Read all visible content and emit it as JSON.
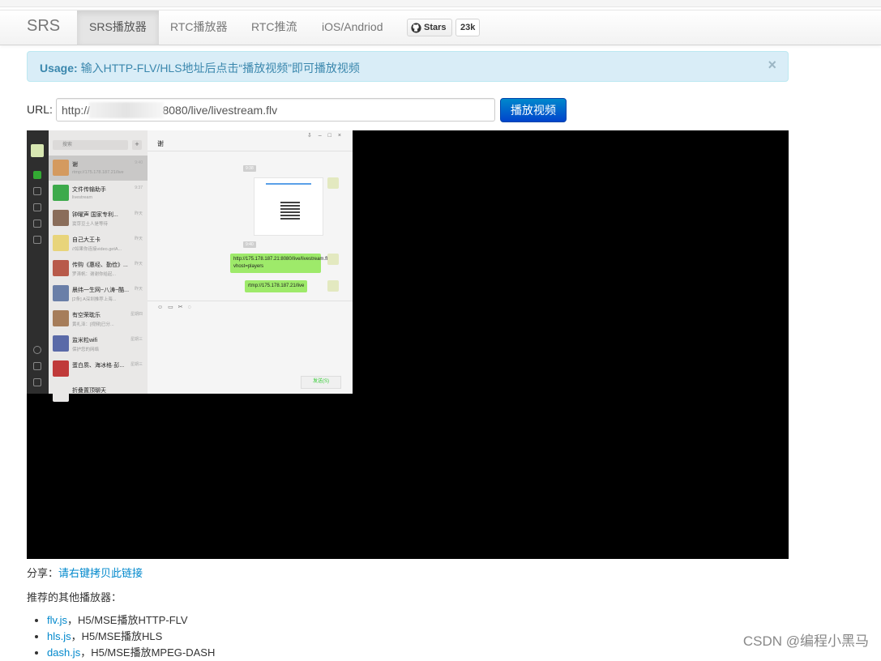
{
  "navbar": {
    "brand": "SRS",
    "tabs": [
      {
        "label": "SRS播放器",
        "active": true
      },
      {
        "label": "RTC播放器",
        "active": false
      },
      {
        "label": "RTC推流",
        "active": false
      },
      {
        "label": "iOS/Andriod",
        "active": false
      }
    ],
    "github_stars_label": "Stars",
    "github_stars_count": "23k"
  },
  "alert": {
    "title": "Usage:",
    "message": "输入HTTP-FLV/HLS地址后点击“播放视频”即可播放视频",
    "close": "×"
  },
  "url_form": {
    "label": "URL:",
    "value": "http://                    1:8080/live/livestream.flv",
    "button": "播放视频"
  },
  "video_content": {
    "app_title": "谢",
    "search_placeholder": "搜索",
    "plus": "+",
    "chats": [
      {
        "name": "谢",
        "sub": "rtmp://175.178.187.21/live",
        "time": "9:40",
        "color": "#d49a5f",
        "selected": true
      },
      {
        "name": "文件传输助手",
        "sub": "livestream",
        "time": "9:37",
        "color": "#3daa4b",
        "selected": false
      },
      {
        "name": "钟曜声 国家专利...",
        "sub": "窦芽豆土人是等待",
        "time": "昨天",
        "color": "#8a6d5a",
        "selected": false
      },
      {
        "name": "自己大王卡",
        "sub": "//如果你连接video.getA...",
        "time": "昨天",
        "color": "#e8d47a",
        "selected": false
      },
      {
        "name": "传购《惠经、勤俭》...",
        "sub": "罗涛帆：谢谢你给起...",
        "time": "昨天",
        "color": "#b85a4a",
        "selected": false
      },
      {
        "name": "晨纬一生网~八涛~酷...",
        "sub": "[2条] A深圳推荐上海...",
        "time": "昨天",
        "color": "#6a7fa8",
        "selected": false
      },
      {
        "name": "有空荣耽乐",
        "sub": "黄礼泽：[视频]已分...",
        "time": "星期四",
        "color": "#a67d5a",
        "selected": false
      },
      {
        "name": "监米粒wifi",
        "sub": "保护您的网络",
        "time": "星期三",
        "color": "#5a6aa8",
        "selected": false
      },
      {
        "name": "蛋白质、海冰格·彭...",
        "sub": "",
        "time": "星期三",
        "color": "#c03a3a",
        "selected": false
      },
      {
        "name": "折叠置顶聊天",
        "sub": "",
        "time": "",
        "color": "#e9e8e7",
        "selected": false
      }
    ],
    "messages": [
      "http://175.178.187.21:8080/live/livestream.flv?vhost=players",
      "rtmp://175.178.187.21/live"
    ],
    "send": "发送(S)"
  },
  "share": {
    "label": "分享：",
    "link": "请右键拷贝此链接"
  },
  "players": {
    "title": "推荐的其他播放器：",
    "items": [
      {
        "name": "flv.js",
        "desc": "，H5/MSE播放HTTP-FLV"
      },
      {
        "name": "hls.js",
        "desc": "，H5/MSE播放HLS"
      },
      {
        "name": "dash.js",
        "desc": "，H5/MSE播放MPEG-DASH"
      }
    ]
  },
  "watermark": "CSDN @编程小黑马"
}
